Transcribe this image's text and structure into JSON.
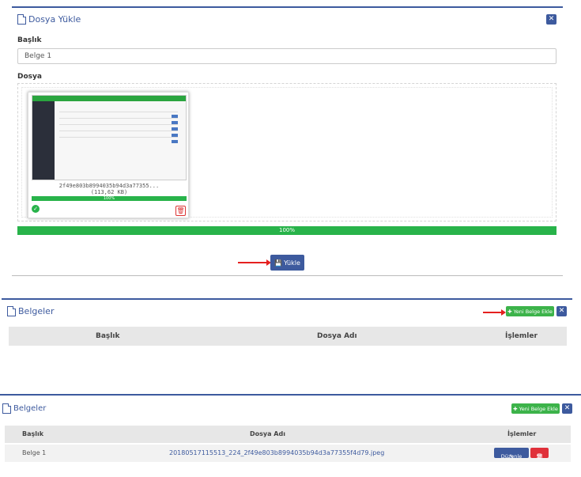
{
  "upload_panel": {
    "title": "Dosya Yükle",
    "baslik_label": "Başlık",
    "baslik_value": "Belge 1",
    "dosya_label": "Dosya",
    "file_preview": {
      "name": "2f49e803b8994035b94d3a77355...",
      "size": "(113,62 KB)",
      "progress_text": "100%",
      "progress": 1.0
    },
    "total_progress_text": "100%",
    "total_progress": 1.0,
    "upload_button_label": "Yükle"
  },
  "documents_panel_empty": {
    "title": "Belgeler",
    "add_button_label": "Yeni Belge Ekle",
    "columns": [
      "Başlık",
      "Dosya Adı",
      "İşlemler"
    ]
  },
  "documents_panel_filled": {
    "title": "Belgeler",
    "add_button_label": "Yeni Belge Ekle",
    "columns": [
      "Başlık",
      "Dosya Adı",
      "İşlemler"
    ],
    "rows": [
      {
        "baslik": "Belge 1",
        "dosya_adi": "20180517115513_224_2f49e803b8994035b94d3a77355f4d79.jpeg",
        "edit_label": "Düzenle",
        "delete_label": "Sil"
      }
    ]
  },
  "colors": {
    "primary": "#3d5a9e",
    "success": "#28b34a",
    "danger": "#e0303a",
    "annotation_arrow": "#e5201f"
  }
}
